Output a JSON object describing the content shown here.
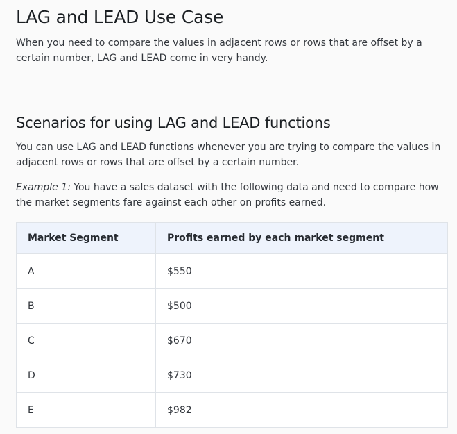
{
  "article": {
    "title": "LAG and LEAD Use Case",
    "intro": "When you need to compare the values in adjacent rows or rows that are offset by a certain number, LAG and LEAD come in very handy.",
    "section_title": "Scenarios for using LAG and LEAD functions",
    "section_text": "You can use LAG and LEAD functions whenever you are trying to compare the values in adjacent rows or rows that are offset by a certain number.",
    "example_label": "Example 1:",
    "example_text": " You have a sales dataset with the following data and need to compare how the market segments fare against each other on profits earned."
  },
  "table": {
    "headers": [
      "Market Segment",
      "Profits earned by each market segment"
    ],
    "rows": [
      [
        "A",
        "$550"
      ],
      [
        "B",
        "$500"
      ],
      [
        "C",
        "$670"
      ],
      [
        "D",
        "$730"
      ],
      [
        "E",
        "$982"
      ]
    ]
  }
}
